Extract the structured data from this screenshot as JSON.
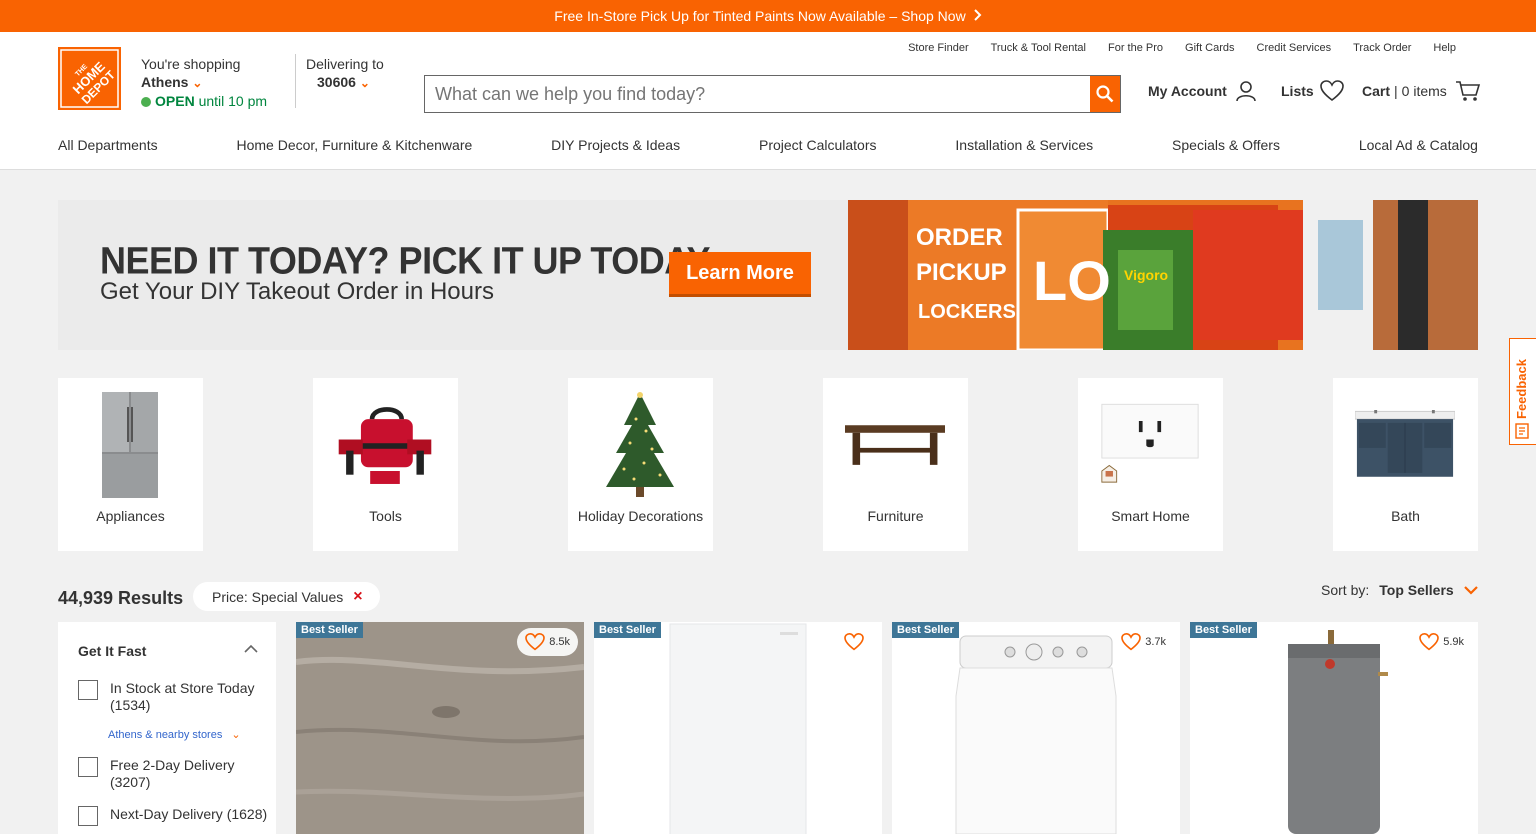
{
  "promo": {
    "text": "Free In-Store Pick Up for Tinted Paints Now Available – Shop Now"
  },
  "store": {
    "shopping_label": "You're shopping",
    "city": "Athens",
    "open": "OPEN",
    "hours": " until 10 pm"
  },
  "delivery": {
    "label": "Delivering to",
    "zip": "30606"
  },
  "util_links": [
    "Store Finder",
    "Truck & Tool Rental",
    "For the Pro",
    "Gift Cards",
    "Credit Services",
    "Track Order",
    "Help"
  ],
  "search": {
    "placeholder": "What can we help you find today?"
  },
  "account": {
    "label": "My Account"
  },
  "lists": {
    "label": "Lists"
  },
  "cart": {
    "label": "Cart",
    "sep": " | ",
    "items": "0 items"
  },
  "nav": [
    "All Departments",
    "Home Decor, Furniture & Kitchenware",
    "DIY Projects & Ideas",
    "Project Calculators",
    "Installation & Services",
    "Specials & Offers",
    "Local Ad & Catalog"
  ],
  "hero": {
    "headline": "NEED IT TODAY? PICK IT UP TODAY.",
    "subhead": "Get Your DIY Takeout Order in Hours",
    "cta": "Learn More",
    "locker_text_1": "ORDER",
    "locker_text_2": "PICKUP",
    "locker_text_3": "LOCKERS",
    "locker_text_4": "LO",
    "bag_text": "Vigoro"
  },
  "categories": [
    {
      "label": "Appliances"
    },
    {
      "label": "Tools"
    },
    {
      "label": "Holiday Decorations"
    },
    {
      "label": "Furniture"
    },
    {
      "label": "Smart Home"
    },
    {
      "label": "Bath"
    }
  ],
  "results": {
    "count": "44,939 Results",
    "filter": "Price: Special Values",
    "filter_remove": "×",
    "sort_label": "Sort by:",
    "sort_value": "Top Sellers"
  },
  "sidebar": {
    "title": "Get It Fast",
    "options": [
      {
        "label": "In Stock at Store Today (1534)"
      },
      {
        "label": "Free 2-Day Delivery (3207)"
      },
      {
        "label": "Next-Day Delivery (1628)"
      }
    ],
    "nearby": "Athens & nearby stores"
  },
  "products": [
    {
      "badge": "Best Seller",
      "favs": "8.5k"
    },
    {
      "badge": "Best Seller",
      "favs": ""
    },
    {
      "badge": "Best Seller",
      "favs": "3.7k"
    },
    {
      "badge": "Best Seller",
      "favs": "5.9k"
    }
  ],
  "feedback": {
    "label": "Feedback"
  },
  "colors": {
    "brand": "#f96302",
    "badge": "#3e7697",
    "open": "#00853e"
  }
}
